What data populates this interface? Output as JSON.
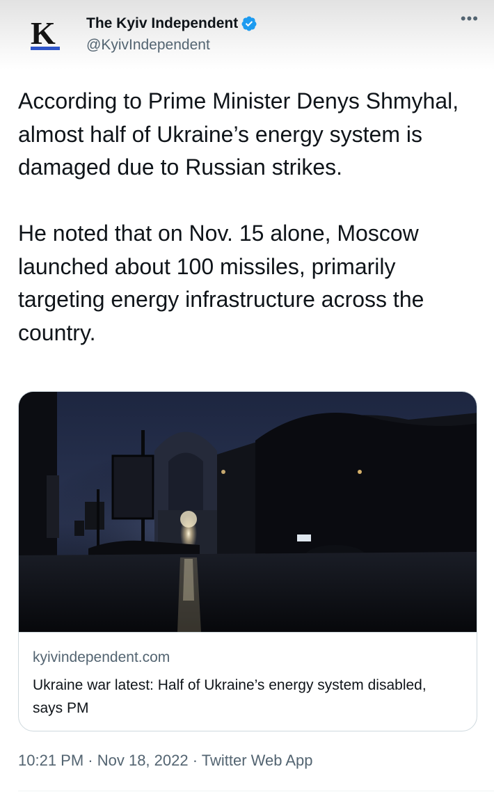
{
  "account": {
    "name": "The Kyiv Independent",
    "handle": "@KyivIndependent",
    "logo_letter": "K",
    "verified_color": "#1d9bf0"
  },
  "menu_icon": "more-horizontal-icon",
  "tweet": {
    "paragraphs": [
      "According to Prime Minister Denys Shmyhal, almost half of Ukraine’s energy system is damaged due to Russian strikes.",
      "He noted that on Nov. 15 alone, Moscow launched about 100 missiles, primarily targeting energy infrastructure across the country."
    ]
  },
  "card": {
    "domain": "kyivindependent.com",
    "title": "Ukraine war latest: Half of Ukraine’s energy system disabled, says PM"
  },
  "meta": {
    "timestamp": "10:21 PM · Nov 18, 2022 · Twitter Web App"
  }
}
